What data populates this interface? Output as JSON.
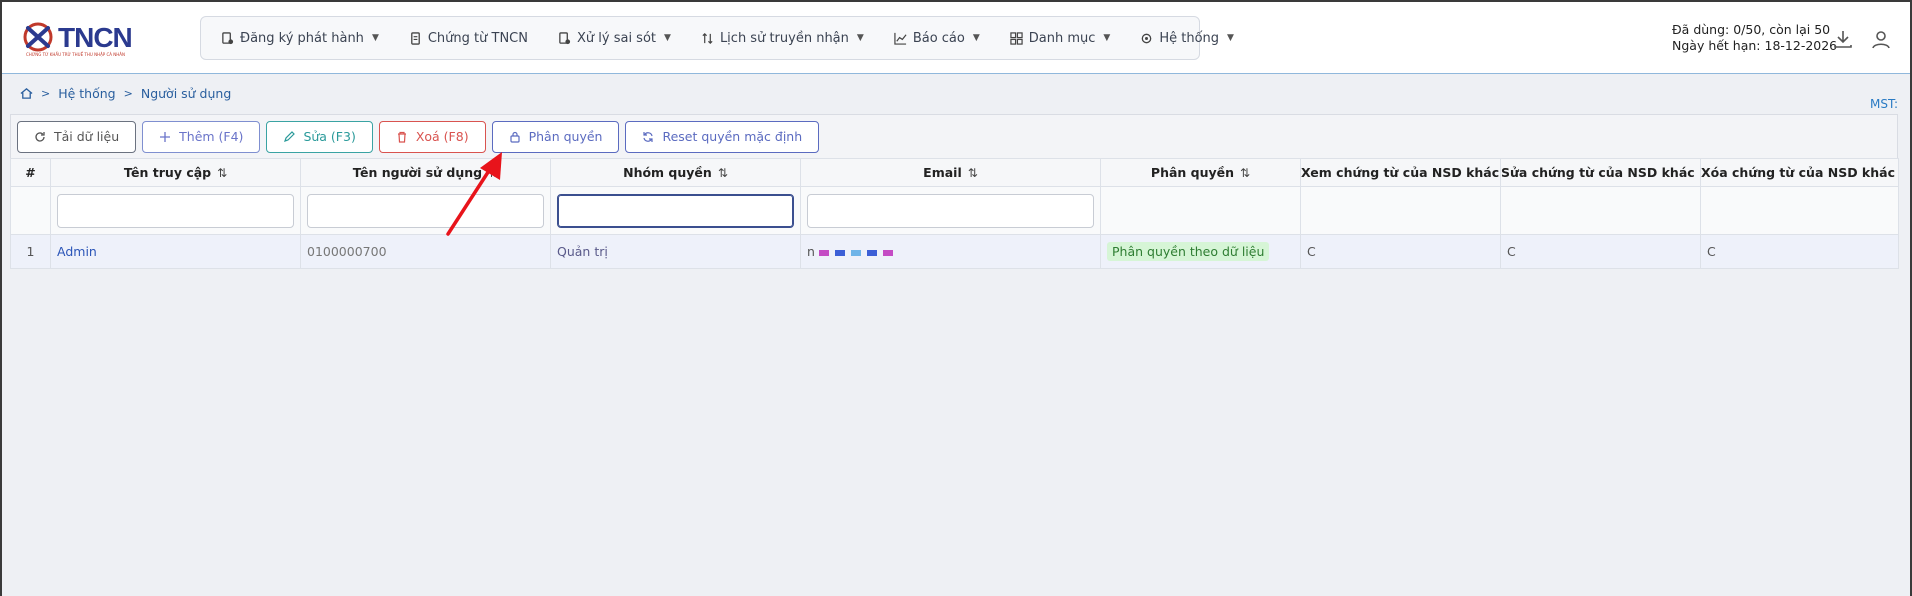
{
  "app": {
    "logo_text": "TNCN",
    "logo_sub": "CHỨNG TỪ KHẤU TRỪ THUẾ THU NHẬP CÁ NHÂN"
  },
  "nav": [
    {
      "label": "Đăng ký phát hành",
      "icon": "register-icon",
      "dropdown": true
    },
    {
      "label": "Chứng từ TNCN",
      "icon": "document-icon",
      "dropdown": false
    },
    {
      "label": "Xử lý sai sót",
      "icon": "fix-icon",
      "dropdown": true
    },
    {
      "label": "Lịch sử truyền nhận",
      "icon": "transfer-icon",
      "dropdown": true
    },
    {
      "label": "Báo cáo",
      "icon": "chart-icon",
      "dropdown": true
    },
    {
      "label": "Danh mục",
      "icon": "grid-icon",
      "dropdown": true
    },
    {
      "label": "Hệ thống",
      "icon": "gear-icon",
      "dropdown": true
    }
  ],
  "header_right": {
    "usage": "Đã dùng: 0/50, còn lại 50",
    "expiry": "Ngày hết hạn: 18-12-2026"
  },
  "breadcrumb": {
    "level1": "Hệ thống",
    "level2": "Người sử dụng"
  },
  "mst_label": "MST:",
  "toolbar": {
    "reload": "Tải dữ liệu",
    "add": "Thêm (F4)",
    "edit": "Sửa (F3)",
    "delete": "Xoá (F8)",
    "permission": "Phân quyền",
    "reset": "Reset quyền mặc định"
  },
  "table": {
    "columns": [
      "#",
      "Tên truy cập",
      "Tên người sử dụng",
      "Nhóm quyền",
      "Email",
      "Phân quyền",
      "Xem chứng từ của NSD khác",
      "Sửa chứng từ của NSD khác",
      "Xóa chứng từ của NSD khác"
    ],
    "rows": [
      {
        "num": "1",
        "username": "Admin",
        "fullname": "0100000700",
        "group": "Quản trị",
        "email": "n",
        "permission": "Phân quyền theo dữ liệu",
        "view": "C",
        "edit": "C",
        "delete": "C"
      }
    ]
  },
  "colors": {
    "accent": "#2b55b8",
    "badge_bg": "#d6f5d6",
    "arrow": "#e8141b"
  }
}
